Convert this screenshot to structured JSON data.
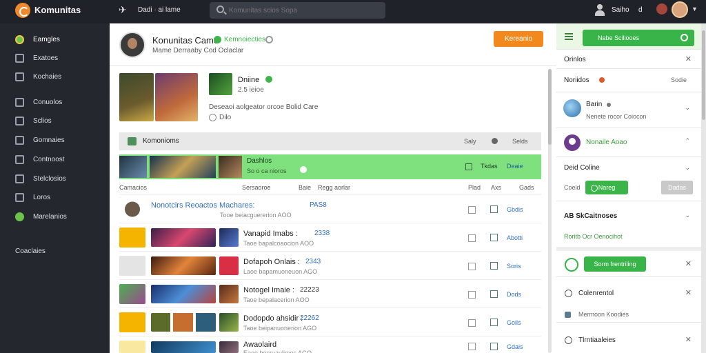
{
  "app": {
    "title": "Komunitas"
  },
  "topbar": {
    "nav_text": "Dadi · ai lame",
    "search_placeholder": "Komunitas scios Sopa",
    "user_label": "Saiho",
    "small_label": "d"
  },
  "sidebar": {
    "items": [
      {
        "label": "Eamgles",
        "icon": "rocket-icon"
      },
      {
        "label": "Exatoes",
        "icon": "square-icon"
      },
      {
        "label": "Kochaies",
        "icon": "window-icon"
      },
      {
        "label": "Conuolos",
        "icon": "grid-icon"
      },
      {
        "label": "Sclios",
        "icon": "chart-icon"
      },
      {
        "label": "Gomnaies",
        "icon": "calendar-icon"
      },
      {
        "label": "Contnoost",
        "icon": "box-icon"
      },
      {
        "label": "Stelclosios",
        "icon": "list-icon"
      },
      {
        "label": "Loros",
        "icon": "page-icon"
      },
      {
        "label": "Marelanios",
        "icon": "puzzle-icon"
      }
    ],
    "footer": "Coaclaies"
  },
  "profile": {
    "name": "Konunitas Came",
    "status": "Kemnoiecties",
    "sub": "Mame Derraaby Cod Oclaclar",
    "cta": "Kereanio"
  },
  "feature": {
    "title": "Dniine",
    "sub": "2.5 ieioe",
    "desc": "Deseaoi aolgeator orcoe Bolid Care",
    "link": "Dilo"
  },
  "section": {
    "title": "Komonioms",
    "c1": "Saly",
    "c2": "Selds"
  },
  "highlight": {
    "title": "Dashlos",
    "sub": "So o ca nioros",
    "l1": "Tkdas",
    "l2": "Deaie"
  },
  "columns": [
    "Camacios",
    "Sersaoroe",
    "Baie",
    "Regg aorlar",
    "Plad",
    "Axs",
    "Gads"
  ],
  "rows": [
    {
      "title": "Nonotcirs  Reoactos Machares:",
      "code": "PAS8",
      "sub": "Tooe beiacguererion  AOO",
      "link": "Gbdis"
    },
    {
      "title": "Vanapid Imabs :",
      "code": "2338",
      "sub": "Taoe bapalcoaocion  AOO",
      "link": "Abotti"
    },
    {
      "title": "Dofapoh Onlais :",
      "code": "2343",
      "sub": "Laoe bapamuoneuon  AGO",
      "link": "Soris"
    },
    {
      "title": "Notogel Imaie :",
      "code": "22223",
      "sub": "Taoe bepalacerion  AOO",
      "link": "Dods"
    },
    {
      "title": "Dodopdo ahsidir :",
      "code": "22262",
      "sub": "Taoe beipanuonerion  AGO",
      "link": "Goils"
    },
    {
      "title": "Awaolaird",
      "code": "",
      "sub": "Eaoe becruaulimes  AGO",
      "link": "Gdais"
    }
  ],
  "right": {
    "top_btn": "Nabe Scillooes",
    "options": "Orinlos",
    "notif": "Noriidos",
    "notif_right": "Sodie",
    "user_name": "Barin",
    "user_sub": "Nenete rocor Coiocon",
    "friends": "Nonaile Aoao",
    "online_title": "Deid Coline",
    "online_label": "Coeld",
    "online_btn": "Nareg",
    "online_gray": "Dadas",
    "ach_title": "AB SkCaitnoses",
    "ach_link": "Roritb Ocr Oenocihot",
    "act_btn": "Sorm frentriling",
    "comm_title": "Colenrentol",
    "comm_sub": "Mermoon Koodies",
    "trans": "Tlrntiaaleies"
  },
  "colors": {
    "accent": "#38b449",
    "orange": "#f2891d",
    "sidebar": "#24282e"
  }
}
